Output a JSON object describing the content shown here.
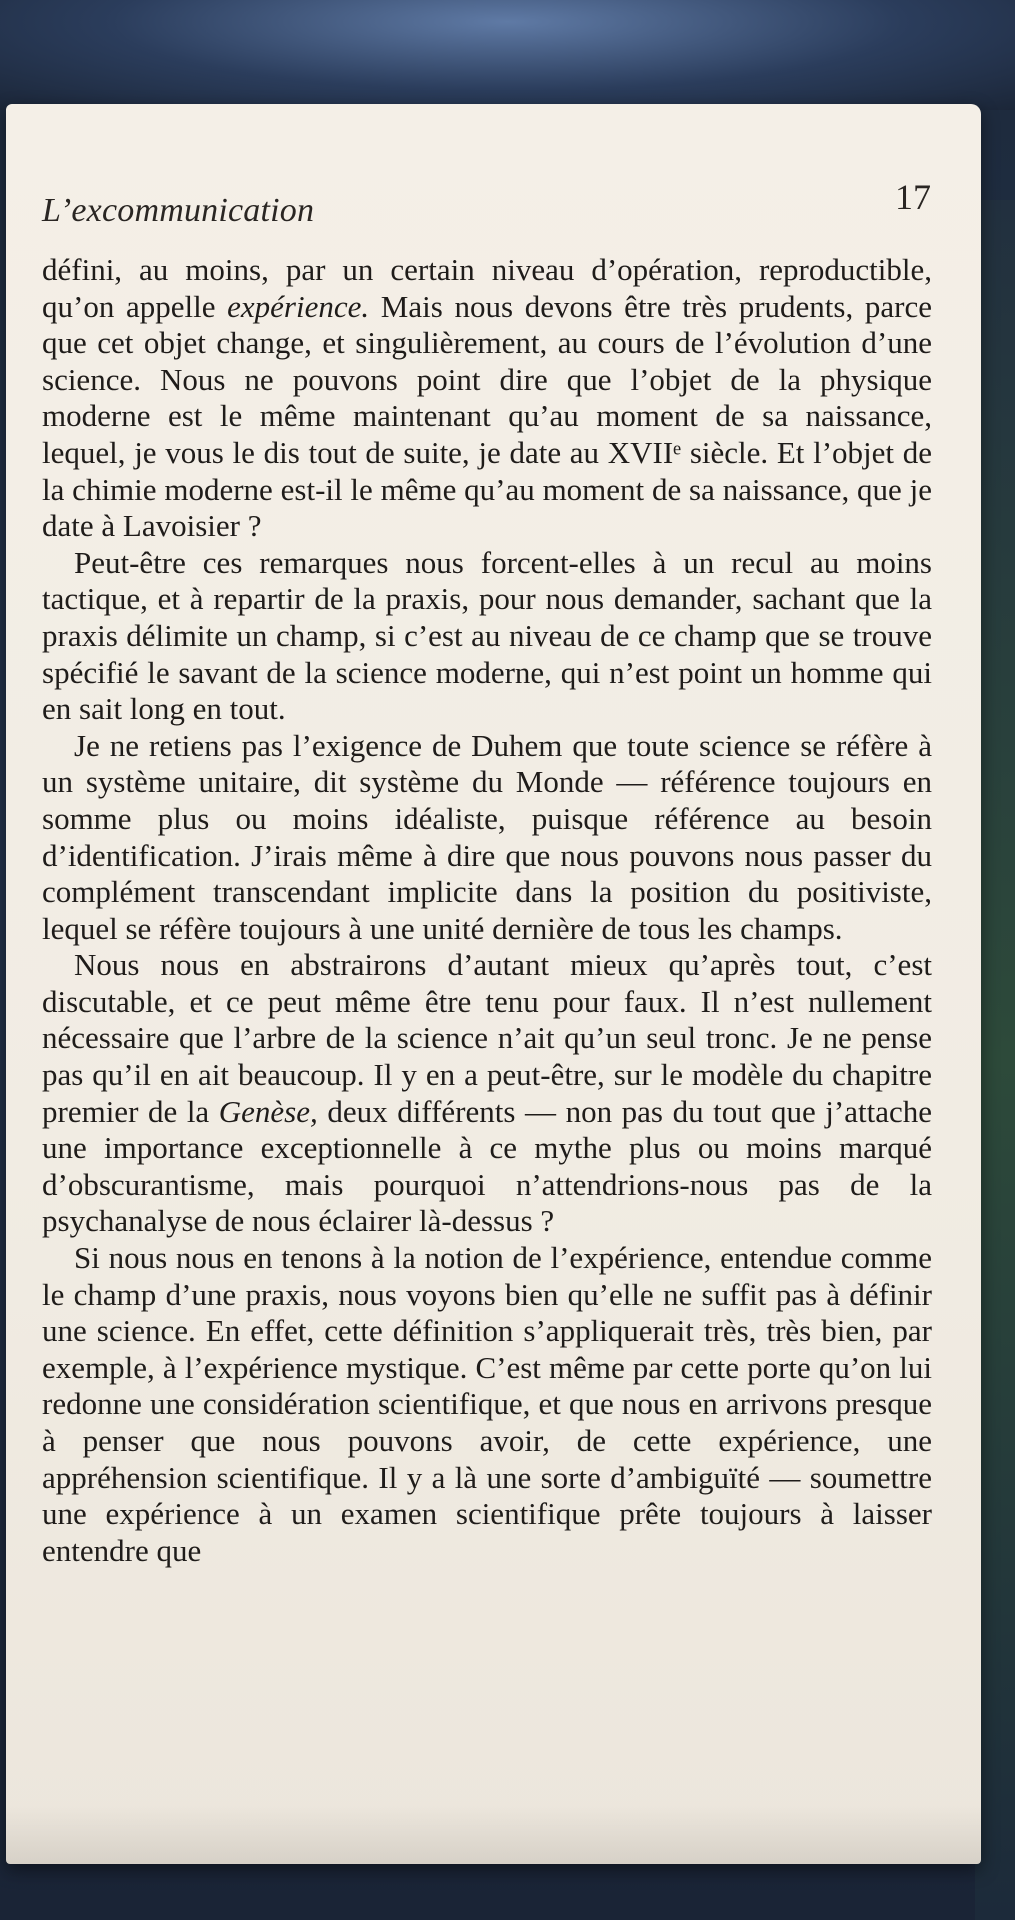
{
  "header": {
    "running_title": "L’excommunication",
    "page_number": "17"
  },
  "paragraphs": [
    {
      "id": "p1",
      "indent": false,
      "segments": [
        {
          "text": "défini, au moins, par un certain niveau d’opération, reproductible, qu’on appelle "
        },
        {
          "text": "expérience.",
          "italic": true
        },
        {
          "text": " Mais nous devons être très prudents, parce que cet objet change, et singulièrement, au cours de l’évolution d’une science. Nous ne pouvons point dire que l’objet de la physique moderne est le même maintenant qu’au moment de sa naissance, lequel, je vous le dis tout de suite, je date au XVIIᵉ siècle. Et l’objet de la chimie moderne est-il le même qu’au moment de sa naissance, que je date à Lavoisier ?"
        }
      ]
    },
    {
      "id": "p2",
      "indent": true,
      "segments": [
        {
          "text": "Peut-être ces remarques nous forcent-elles à un recul au moins tactique, et à repartir de la praxis, pour nous demander, sachant que la praxis délimite un champ, si c’est au niveau de ce champ que se trouve spécifié le savant de la science moderne, qui n’est point un homme qui en sait long en tout."
        }
      ]
    },
    {
      "id": "p3",
      "indent": true,
      "segments": [
        {
          "text": "Je ne retiens pas l’exigence de Duhem que toute science se réfère à un système unitaire, dit système du Monde — référence toujours en somme plus ou moins idéaliste, puisque référence au besoin d’identification. J’irais même à dire que nous pouvons nous passer du complément transcendant implicite dans la position du positiviste, lequel se réfère toujours à une unité dernière de tous les champs."
        }
      ]
    },
    {
      "id": "p4",
      "indent": true,
      "segments": [
        {
          "text": "Nous nous en abstrairons d’autant mieux qu’après tout, c’est discutable, et ce peut même être tenu pour faux. Il n’est nullement nécessaire que l’arbre de la science n’ait qu’un seul tronc. Je ne pense pas qu’il en ait beaucoup. Il y en a peut-être, sur le modèle du chapitre premier de la "
        },
        {
          "text": "Genèse,",
          "italic": true
        },
        {
          "text": " deux différents — non pas du tout que j’attache une importance exceptionnelle à ce mythe plus ou moins marqué d’obscurantisme, mais pourquoi n’attendrions-nous pas de la psychanalyse de nous éclairer là-dessus ?"
        }
      ]
    },
    {
      "id": "p5",
      "indent": true,
      "segments": [
        {
          "text": "Si nous nous en tenons à la notion de l’expérience, entendue comme le champ d’une praxis, nous voyons bien qu’elle ne suffit pas à définir une science. En effet, cette définition s’appliquerait très, très bien, par exemple, à l’expérience mystique. C’est même par cette porte qu’on lui redonne une considération scientifique, et que nous en arrivons presque à penser que nous pouvons avoir, de cette expérience, une appréhension scientifique. Il y a là une sorte d’ambiguïté — soumettre une expérience à un examen scientifique prête toujours à laisser entendre que"
        }
      ]
    }
  ]
}
